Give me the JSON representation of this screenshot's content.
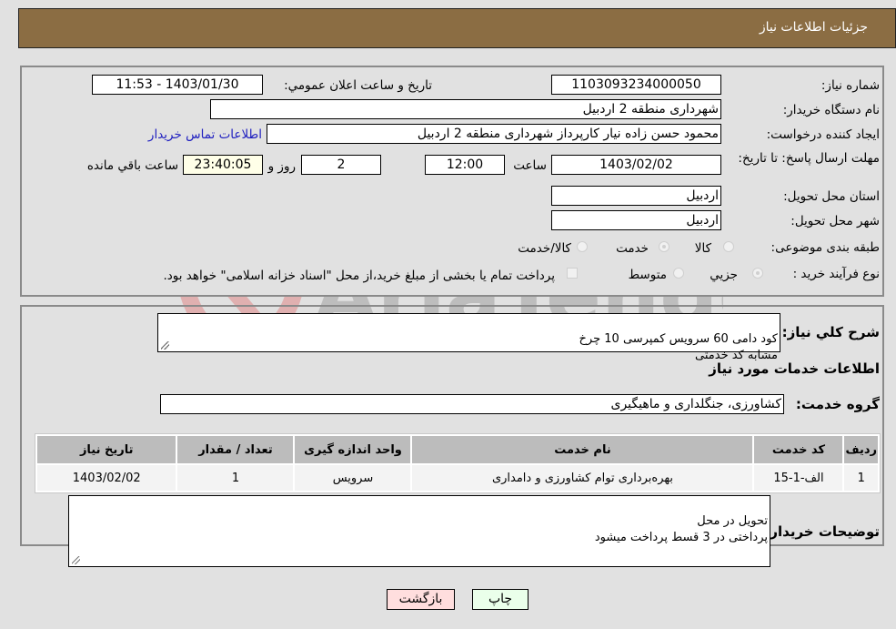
{
  "header": {
    "title": "جزئیات اطلاعات نیاز"
  },
  "fields": {
    "need_number": {
      "label": "شماره نیاز:",
      "value": "1103093234000050"
    },
    "announce_datetime": {
      "label": "تاریخ و ساعت اعلان عمومي:",
      "value": "1403/01/30 - 11:53"
    },
    "buyer_org": {
      "label": "نام دستگاه خريدار:",
      "value": "شهرداری منطقه 2 اردبیل"
    },
    "requester": {
      "label": "ایجاد کننده درخواست:",
      "value": "محمود حسن زاده نیار کارپرداز شهرداری منطقه 2 اردبیل"
    },
    "contact_link": "اطلاعات تماس خریدار",
    "deadline": {
      "label": "مهلت ارسال پاسخ: تا تاریخ:",
      "date": "1403/02/02",
      "time_label": "ساعت",
      "time": "12:00",
      "days": "2",
      "days_label": "روز و",
      "remaining": "23:40:05",
      "remaining_label": "ساعت باقي مانده"
    },
    "province": {
      "label": "استان محل تحویل:",
      "value": "اردبیل"
    },
    "city": {
      "label": "شهر محل تحویل:",
      "value": "اردبیل"
    },
    "category": {
      "label": "طبقه بندی موضوعی:",
      "options": [
        "کالا",
        "خدمت",
        "کالا/خدمت"
      ],
      "selected": "خدمت"
    },
    "purchase_type": {
      "label": "نوع فرآیند خرید :",
      "options": [
        "جزيي",
        "متوسط"
      ],
      "selected": "جزيي",
      "treasury_note": "پرداخت تمام یا بخشی از مبلغ خرید،از محل \"اسناد خزانه اسلامی\" خواهد بود."
    }
  },
  "description": {
    "label": "شرح کلي نياز:",
    "value": "کود دامی 60 سرویس  کمپرسی 10 چرخ\nمشابه کد خدمتی"
  },
  "services_section": {
    "title": "اطلاعات خدمات مورد نیاز",
    "group_label": "گروه خدمت:",
    "group_value": "کشاورزی، جنگلداری و ماهیگیری"
  },
  "table": {
    "columns": [
      "رديف",
      "کد خدمت",
      "نام خدمت",
      "واحد اندازه گيری",
      "تعداد / مقدار",
      "تاریخ نیاز"
    ],
    "rows": [
      [
        "1",
        "الف-1-15",
        "بهره‌برداری توام کشاورزی و دامداری",
        "سرویس",
        "1",
        "1403/02/02"
      ]
    ]
  },
  "buyer_notes": {
    "label": "توضیحات خریدار:",
    "value": "تحویل در محل\nپرداختی در 3 قسط پرداخت میشود"
  },
  "buttons": {
    "print": "چاپ",
    "back": "بازگشت"
  },
  "colors": {
    "header_bg": "#8b6d43",
    "print_bg": "#eaffea",
    "back_bg": "#ffdede",
    "link": "#2020c0"
  },
  "watermark": "AriaTender.neT"
}
